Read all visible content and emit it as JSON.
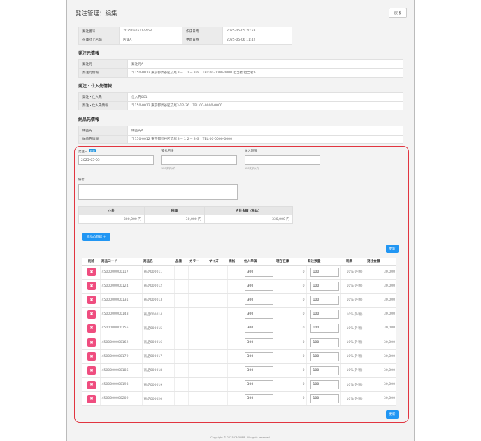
{
  "header": {
    "title": "発注管理：編集",
    "back_label": "戻る"
  },
  "order_info": [
    [
      "発注番号",
      "20250505114458",
      "作成日時",
      "2025-05-05 20:58"
    ],
    [
      "在庫計上店舗",
      "店舗A",
      "更新日時",
      "2025-05-06 11:42"
    ]
  ],
  "supplier": {
    "title": "発注元情報",
    "rows": [
      [
        "発注元",
        "発注元A"
      ],
      [
        "発注元情報",
        "〒150-0012 東京都渋谷区広尾３－１２－３６　TEL:00-0000-0000 担当者:担当者A"
      ]
    ]
  },
  "vendor": {
    "title": "発注・仕入先情報",
    "rows": [
      [
        "発注・仕入先",
        "仕入先001"
      ],
      [
        "発注・仕入先情報",
        "〒150-0012 東京都渋谷区広尾3-12-36　TEL:00-0000-0000"
      ]
    ]
  },
  "delivery": {
    "title": "納品先情報",
    "rows": [
      [
        "納品先",
        "納品先A"
      ],
      [
        "納品先情報",
        "〒150-0012 東京都渋谷区広尾３－１２－３６　TEL:00-0000-0000"
      ]
    ]
  },
  "form": {
    "order_date_label": "発注日",
    "required_badge": "必須",
    "order_date_value": "2025-05-05",
    "payment_label": "支払方法",
    "payment_hint": "128文字以内",
    "due_label": "納入期限",
    "due_hint": "128文字以内",
    "note_label": "備考"
  },
  "summary": {
    "headers": [
      "小計",
      "税額",
      "合計金額（税込）"
    ],
    "values": [
      "300,000 円",
      "30,000 円",
      "330,000 円"
    ]
  },
  "buttons": {
    "add_product": "商品の登録 ＋",
    "update": "更新"
  },
  "items": {
    "headers": [
      "削除",
      "商品コード",
      "商品名",
      "品番",
      "カラー",
      "サイズ",
      "規格",
      "仕入単価",
      "現在在庫",
      "発注数量",
      "税率",
      "発注金額"
    ],
    "delete_glyph": "✖",
    "rows": [
      {
        "code": "4500000000117",
        "name": "商品000011",
        "price": "300",
        "stock": "0",
        "qty": "100",
        "tax": "10%(外税)",
        "amount": "30,000"
      },
      {
        "code": "4500000000124",
        "name": "商品000012",
        "price": "300",
        "stock": "0",
        "qty": "100",
        "tax": "10%(外税)",
        "amount": "30,000"
      },
      {
        "code": "4500000000131",
        "name": "商品000013",
        "price": "300",
        "stock": "0",
        "qty": "100",
        "tax": "10%(外税)",
        "amount": "30,000"
      },
      {
        "code": "4500000000148",
        "name": "商品000014",
        "price": "300",
        "stock": "0",
        "qty": "100",
        "tax": "10%(外税)",
        "amount": "30,000"
      },
      {
        "code": "4500000000155",
        "name": "商品000015",
        "price": "300",
        "stock": "0",
        "qty": "100",
        "tax": "10%(外税)",
        "amount": "30,000"
      },
      {
        "code": "4500000000162",
        "name": "商品000016",
        "price": "300",
        "stock": "0",
        "qty": "100",
        "tax": "10%(外税)",
        "amount": "30,000"
      },
      {
        "code": "4500000000179",
        "name": "商品000017",
        "price": "300",
        "stock": "0",
        "qty": "100",
        "tax": "10%(外税)",
        "amount": "30,000"
      },
      {
        "code": "4500000000186",
        "name": "商品000018",
        "price": "300",
        "stock": "0",
        "qty": "100",
        "tax": "10%(外税)",
        "amount": "30,000"
      },
      {
        "code": "4500000000193",
        "name": "商品000019",
        "price": "300",
        "stock": "0",
        "qty": "100",
        "tax": "10%(外税)",
        "amount": "30,000"
      },
      {
        "code": "4500000000209",
        "name": "商品000020",
        "price": "300",
        "stock": "0",
        "qty": "100",
        "tax": "10%(外税)",
        "amount": "30,000"
      }
    ]
  },
  "footer": "Copyright © 2025 CASHIER. All rights reserved."
}
